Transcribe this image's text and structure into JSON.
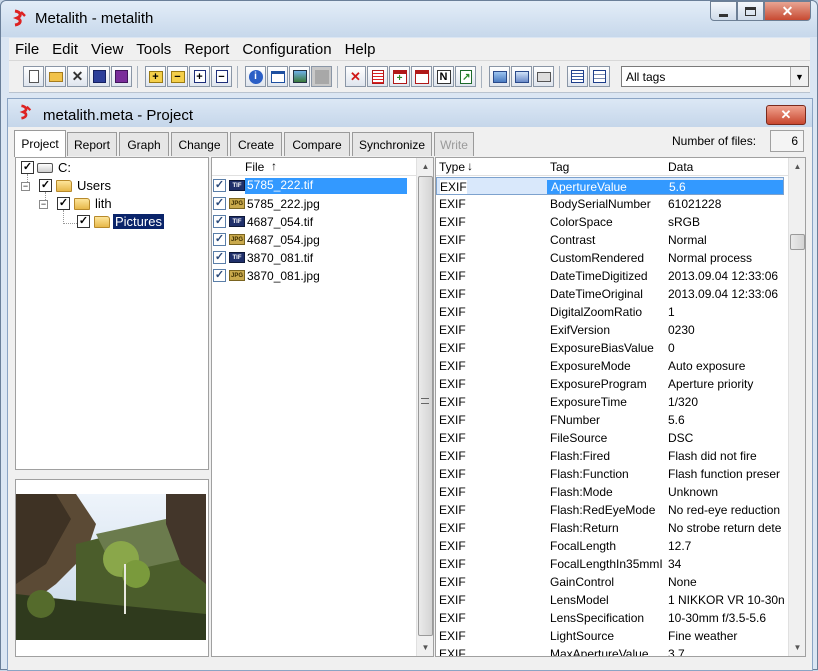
{
  "window": {
    "title": "Metalith - metalith"
  },
  "menu": [
    "File",
    "Edit",
    "View",
    "Tools",
    "Report",
    "Configuration",
    "Help"
  ],
  "toolbar": {
    "tag_filter": "All tags",
    "icons": [
      "new-icon",
      "open-icon",
      "close-file-icon",
      "save-icon",
      "save-as-icon",
      "add-icon",
      "remove-icon",
      "add-file-icon",
      "remove-file-icon",
      "info-icon",
      "window-icon",
      "image-icon",
      "gray-icon",
      "delete-tag-icon",
      "list-red-icon",
      "calendar-add-icon",
      "calendar-red-icon",
      "n-icon",
      "export-icon",
      "find-icon",
      "report-icon",
      "print-icon",
      "list-view-icon",
      "details-view-icon"
    ]
  },
  "project_window": {
    "title": "metalith.meta - Project"
  },
  "tabs": [
    {
      "label": "Project",
      "active": true
    },
    {
      "label": "Report"
    },
    {
      "label": "Graph"
    },
    {
      "label": "Change"
    },
    {
      "label": "Create"
    },
    {
      "label": "Compare"
    },
    {
      "label": "Synchronize"
    },
    {
      "label": "Write",
      "disabled": true
    }
  ],
  "files_count": {
    "label": "Number of files:",
    "value": "6"
  },
  "tree": [
    {
      "label": "C:",
      "checked": true
    },
    {
      "label": "Users",
      "checked": true
    },
    {
      "label": "lith",
      "checked": true
    },
    {
      "label": "Pictures",
      "checked": true,
      "selected": true
    }
  ],
  "file_list": {
    "header": "File",
    "sort_indicator": "↑",
    "rows": [
      {
        "name": "5785_222.tif",
        "type": "TIF",
        "checked": true,
        "selected": true
      },
      {
        "name": "5785_222.jpg",
        "type": "JPG",
        "checked": true
      },
      {
        "name": "4687_054.tif",
        "type": "TIF",
        "checked": true
      },
      {
        "name": "4687_054.jpg",
        "type": "JPG",
        "checked": true
      },
      {
        "name": "3870_081.tif",
        "type": "TIF",
        "checked": true
      },
      {
        "name": "3870_081.jpg",
        "type": "JPG",
        "checked": true
      }
    ]
  },
  "tag_table": {
    "headers": {
      "type": "Type",
      "tag": "Tag",
      "data": "Data"
    },
    "sort_indicator": "↓",
    "rows": [
      {
        "type": "EXIF",
        "tag": "ApertureValue",
        "data": "5.6",
        "selected": true
      },
      {
        "type": "EXIF",
        "tag": "BodySerialNumber",
        "data": "61021228"
      },
      {
        "type": "EXIF",
        "tag": "ColorSpace",
        "data": "sRGB"
      },
      {
        "type": "EXIF",
        "tag": "Contrast",
        "data": "Normal"
      },
      {
        "type": "EXIF",
        "tag": "CustomRendered",
        "data": "Normal process"
      },
      {
        "type": "EXIF",
        "tag": "DateTimeDigitized",
        "data": "2013.09.04 12:33:06"
      },
      {
        "type": "EXIF",
        "tag": "DateTimeOriginal",
        "data": "2013.09.04 12:33:06"
      },
      {
        "type": "EXIF",
        "tag": "DigitalZoomRatio",
        "data": "1"
      },
      {
        "type": "EXIF",
        "tag": "ExifVersion",
        "data": "0230"
      },
      {
        "type": "EXIF",
        "tag": "ExposureBiasValue",
        "data": "0"
      },
      {
        "type": "EXIF",
        "tag": "ExposureMode",
        "data": "Auto exposure"
      },
      {
        "type": "EXIF",
        "tag": "ExposureProgram",
        "data": "Aperture priority"
      },
      {
        "type": "EXIF",
        "tag": "ExposureTime",
        "data": "1/320"
      },
      {
        "type": "EXIF",
        "tag": "FNumber",
        "data": "5.6"
      },
      {
        "type": "EXIF",
        "tag": "FileSource",
        "data": "DSC"
      },
      {
        "type": "EXIF",
        "tag": "Flash:Fired",
        "data": "Flash did not fire"
      },
      {
        "type": "EXIF",
        "tag": "Flash:Function",
        "data": "Flash function preser"
      },
      {
        "type": "EXIF",
        "tag": "Flash:Mode",
        "data": "Unknown"
      },
      {
        "type": "EXIF",
        "tag": "Flash:RedEyeMode",
        "data": "No red-eye reduction"
      },
      {
        "type": "EXIF",
        "tag": "Flash:Return",
        "data": "No strobe return dete"
      },
      {
        "type": "EXIF",
        "tag": "FocalLength",
        "data": "12.7"
      },
      {
        "type": "EXIF",
        "tag": "FocalLengthIn35mmI",
        "data": "34"
      },
      {
        "type": "EXIF",
        "tag": "GainControl",
        "data": "None"
      },
      {
        "type": "EXIF",
        "tag": "LensModel",
        "data": "1 NIKKOR VR 10-30n"
      },
      {
        "type": "EXIF",
        "tag": "LensSpecification",
        "data": "10-30mm f/3.5-5.6"
      },
      {
        "type": "EXIF",
        "tag": "LightSource",
        "data": "Fine weather"
      },
      {
        "type": "EXIF",
        "tag": "MaxApertureValue",
        "data": "3.7"
      }
    ]
  }
}
